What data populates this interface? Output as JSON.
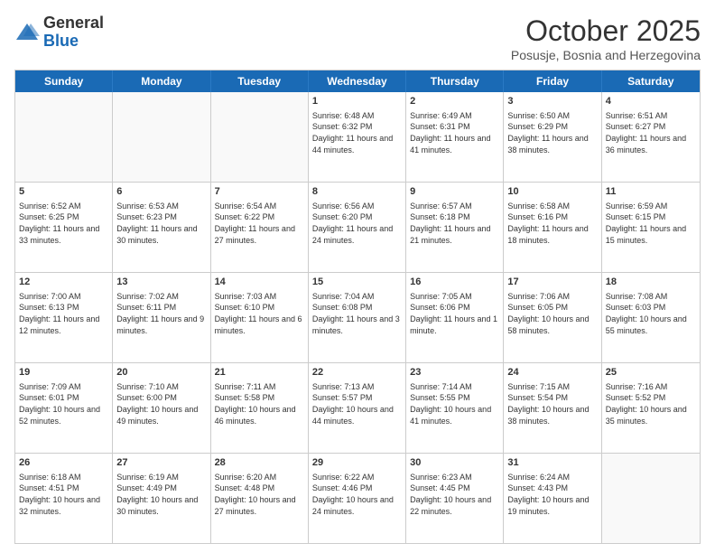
{
  "header": {
    "logo_general": "General",
    "logo_blue": "Blue",
    "month_title": "October 2025",
    "location": "Posusje, Bosnia and Herzegovina"
  },
  "days_of_week": [
    "Sunday",
    "Monday",
    "Tuesday",
    "Wednesday",
    "Thursday",
    "Friday",
    "Saturday"
  ],
  "weeks": [
    [
      {
        "day": "",
        "empty": true
      },
      {
        "day": "",
        "empty": true
      },
      {
        "day": "",
        "empty": true
      },
      {
        "day": "1",
        "sunrise": "6:48 AM",
        "sunset": "6:32 PM",
        "daylight": "11 hours and 44 minutes."
      },
      {
        "day": "2",
        "sunrise": "6:49 AM",
        "sunset": "6:31 PM",
        "daylight": "11 hours and 41 minutes."
      },
      {
        "day": "3",
        "sunrise": "6:50 AM",
        "sunset": "6:29 PM",
        "daylight": "11 hours and 38 minutes."
      },
      {
        "day": "4",
        "sunrise": "6:51 AM",
        "sunset": "6:27 PM",
        "daylight": "11 hours and 36 minutes."
      }
    ],
    [
      {
        "day": "5",
        "sunrise": "6:52 AM",
        "sunset": "6:25 PM",
        "daylight": "11 hours and 33 minutes."
      },
      {
        "day": "6",
        "sunrise": "6:53 AM",
        "sunset": "6:23 PM",
        "daylight": "11 hours and 30 minutes."
      },
      {
        "day": "7",
        "sunrise": "6:54 AM",
        "sunset": "6:22 PM",
        "daylight": "11 hours and 27 minutes."
      },
      {
        "day": "8",
        "sunrise": "6:56 AM",
        "sunset": "6:20 PM",
        "daylight": "11 hours and 24 minutes."
      },
      {
        "day": "9",
        "sunrise": "6:57 AM",
        "sunset": "6:18 PM",
        "daylight": "11 hours and 21 minutes."
      },
      {
        "day": "10",
        "sunrise": "6:58 AM",
        "sunset": "6:16 PM",
        "daylight": "11 hours and 18 minutes."
      },
      {
        "day": "11",
        "sunrise": "6:59 AM",
        "sunset": "6:15 PM",
        "daylight": "11 hours and 15 minutes."
      }
    ],
    [
      {
        "day": "12",
        "sunrise": "7:00 AM",
        "sunset": "6:13 PM",
        "daylight": "11 hours and 12 minutes."
      },
      {
        "day": "13",
        "sunrise": "7:02 AM",
        "sunset": "6:11 PM",
        "daylight": "11 hours and 9 minutes."
      },
      {
        "day": "14",
        "sunrise": "7:03 AM",
        "sunset": "6:10 PM",
        "daylight": "11 hours and 6 minutes."
      },
      {
        "day": "15",
        "sunrise": "7:04 AM",
        "sunset": "6:08 PM",
        "daylight": "11 hours and 3 minutes."
      },
      {
        "day": "16",
        "sunrise": "7:05 AM",
        "sunset": "6:06 PM",
        "daylight": "11 hours and 1 minute."
      },
      {
        "day": "17",
        "sunrise": "7:06 AM",
        "sunset": "6:05 PM",
        "daylight": "10 hours and 58 minutes."
      },
      {
        "day": "18",
        "sunrise": "7:08 AM",
        "sunset": "6:03 PM",
        "daylight": "10 hours and 55 minutes."
      }
    ],
    [
      {
        "day": "19",
        "sunrise": "7:09 AM",
        "sunset": "6:01 PM",
        "daylight": "10 hours and 52 minutes."
      },
      {
        "day": "20",
        "sunrise": "7:10 AM",
        "sunset": "6:00 PM",
        "daylight": "10 hours and 49 minutes."
      },
      {
        "day": "21",
        "sunrise": "7:11 AM",
        "sunset": "5:58 PM",
        "daylight": "10 hours and 46 minutes."
      },
      {
        "day": "22",
        "sunrise": "7:13 AM",
        "sunset": "5:57 PM",
        "daylight": "10 hours and 44 minutes."
      },
      {
        "day": "23",
        "sunrise": "7:14 AM",
        "sunset": "5:55 PM",
        "daylight": "10 hours and 41 minutes."
      },
      {
        "day": "24",
        "sunrise": "7:15 AM",
        "sunset": "5:54 PM",
        "daylight": "10 hours and 38 minutes."
      },
      {
        "day": "25",
        "sunrise": "7:16 AM",
        "sunset": "5:52 PM",
        "daylight": "10 hours and 35 minutes."
      }
    ],
    [
      {
        "day": "26",
        "sunrise": "6:18 AM",
        "sunset": "4:51 PM",
        "daylight": "10 hours and 32 minutes."
      },
      {
        "day": "27",
        "sunrise": "6:19 AM",
        "sunset": "4:49 PM",
        "daylight": "10 hours and 30 minutes."
      },
      {
        "day": "28",
        "sunrise": "6:20 AM",
        "sunset": "4:48 PM",
        "daylight": "10 hours and 27 minutes."
      },
      {
        "day": "29",
        "sunrise": "6:22 AM",
        "sunset": "4:46 PM",
        "daylight": "10 hours and 24 minutes."
      },
      {
        "day": "30",
        "sunrise": "6:23 AM",
        "sunset": "4:45 PM",
        "daylight": "10 hours and 22 minutes."
      },
      {
        "day": "31",
        "sunrise": "6:24 AM",
        "sunset": "4:43 PM",
        "daylight": "10 hours and 19 minutes."
      },
      {
        "day": "",
        "empty": true
      }
    ]
  ]
}
